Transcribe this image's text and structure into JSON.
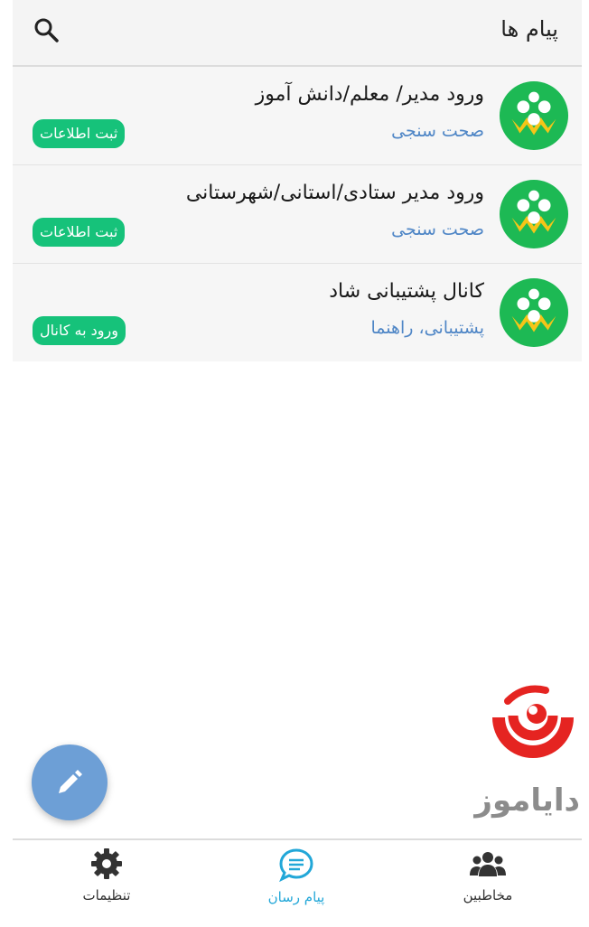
{
  "header": {
    "title": "پیام ها",
    "search_icon": "search-icon"
  },
  "conversations": [
    {
      "name": "ورود مدیر/ معلم/دانش آموز",
      "subtitle": "صحت سنجی",
      "action": "ثبت اطلاعات",
      "avatar_icon": "shad-logo"
    },
    {
      "name": "ورود مدیر ستادی/استانی/شهرستانی",
      "subtitle": "صحت سنجی",
      "action": "ثبت اطلاعات",
      "avatar_icon": "shad-logo"
    },
    {
      "name": "کانال پشتیبانی شاد",
      "subtitle": "پشتیبانی، راهنما",
      "action": "ورود به کانال",
      "avatar_icon": "shad-logo"
    }
  ],
  "brand": {
    "name": "دایاموز"
  },
  "fab": {
    "icon": "pencil-icon"
  },
  "bottom_nav": {
    "settings": {
      "label": "تنظیمات",
      "icon": "gear-icon"
    },
    "messages": {
      "label": "پیام رسان",
      "icon": "chat-icon"
    },
    "contacts": {
      "label": "مخاطبین",
      "icon": "people-icon"
    }
  },
  "colors": {
    "accent_green": "#16c27a",
    "subtitle_blue": "#4f86c6",
    "active_tab": "#22a7d8",
    "fab": "#6d9fd6",
    "brand_red": "#e52421",
    "avatar_green": "#1db954",
    "avatar_yellow": "#f5c518"
  }
}
